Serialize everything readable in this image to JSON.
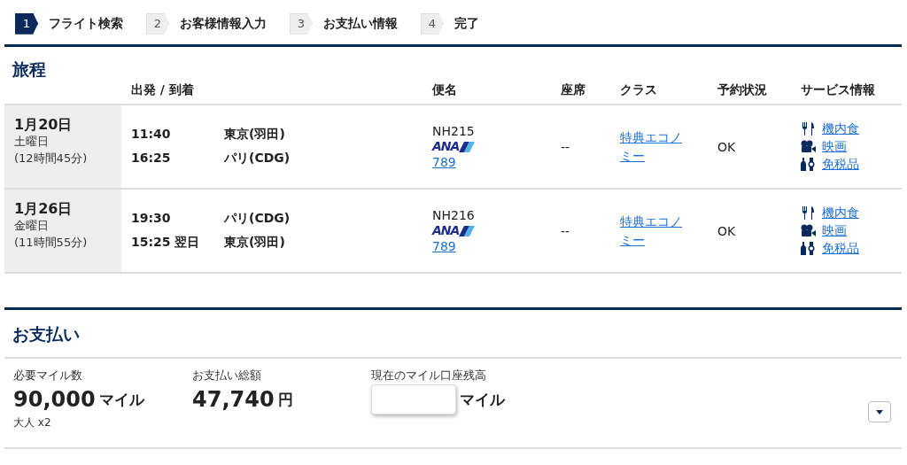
{
  "steps": [
    {
      "number": "1",
      "label": "フライト検索",
      "selected": true
    },
    {
      "number": "2",
      "label": "お客様情報入力",
      "selected": false
    },
    {
      "number": "3",
      "label": "お支払い情報",
      "selected": false
    },
    {
      "number": "4",
      "label": "完了",
      "selected": false
    }
  ],
  "itinerary": {
    "title": "旅程",
    "columns": [
      "出発 / 到着",
      "便名",
      "座席",
      "クラス",
      "予約状況",
      "サービス情報"
    ],
    "rows": [
      {
        "date": "1月20日",
        "weekday": "土曜日",
        "duration": "(12時間45分)",
        "legs": [
          {
            "time": "11:40",
            "airport": "東京(羽田)"
          },
          {
            "time": "16:25",
            "airport": "パリ(CDG)"
          }
        ],
        "flight": "NH215",
        "airline": "ANA",
        "aircraft": "789",
        "seat": "--",
        "class": "特典エコノミー",
        "status": "OK",
        "services": [
          {
            "kind": "meal",
            "label": "機内食"
          },
          {
            "kind": "movie",
            "label": "映画"
          },
          {
            "kind": "dutyfree",
            "label": "免税品"
          }
        ]
      },
      {
        "date": "1月26日",
        "weekday": "金曜日",
        "duration": "(11時間55分)",
        "legs": [
          {
            "time": "19:30",
            "airport": "パリ(CDG)"
          },
          {
            "time": "15:25 翌日",
            "airport": "東京(羽田)"
          }
        ],
        "flight": "NH216",
        "airline": "ANA",
        "aircraft": "789",
        "seat": "--",
        "class": "特典エコノミー",
        "status": "OK",
        "services": [
          {
            "kind": "meal",
            "label": "機内食"
          },
          {
            "kind": "movie",
            "label": "映画"
          },
          {
            "kind": "dutyfree",
            "label": "免税品"
          }
        ]
      }
    ]
  },
  "payment": {
    "title": "お支払い",
    "miles": {
      "label": "必要マイル数",
      "value": "90,000",
      "unit": "マイル",
      "note": "大人 x2"
    },
    "total": {
      "label": "お支払い総額",
      "value": "47,740",
      "unit": "円"
    },
    "balance": {
      "label": "現在のマイル口座残高",
      "unit": "マイル"
    }
  }
}
